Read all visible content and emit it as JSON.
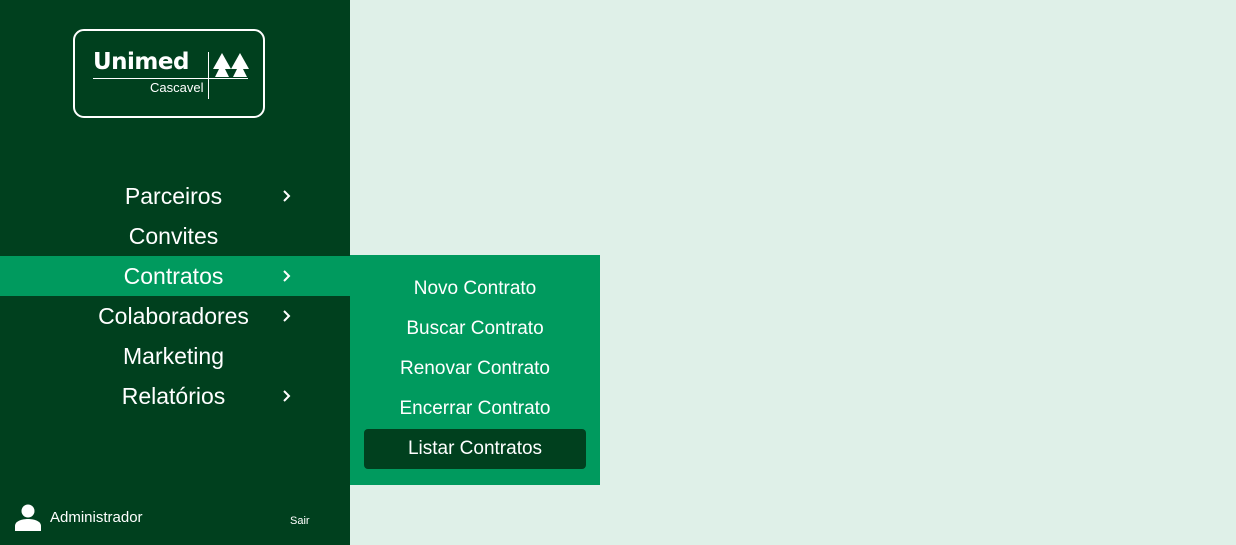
{
  "brand": {
    "name": "Unimed",
    "city": "Cascavel"
  },
  "nav": {
    "items": [
      {
        "label": "Parceiros",
        "has_submenu": true
      },
      {
        "label": "Convites",
        "has_submenu": false
      },
      {
        "label": "Contratos",
        "has_submenu": true,
        "active": true
      },
      {
        "label": "Colaboradores",
        "has_submenu": true
      },
      {
        "label": "Marketing",
        "has_submenu": false
      },
      {
        "label": "Relatórios",
        "has_submenu": true
      }
    ],
    "chevron_icon": "chevron-right-icon"
  },
  "submenu": {
    "parent": "Contratos",
    "items": [
      {
        "label": "Novo Contrato"
      },
      {
        "label": "Buscar Contrato"
      },
      {
        "label": "Renovar Contrato"
      },
      {
        "label": "Encerrar Contrato"
      },
      {
        "label": "Listar Contratos",
        "selected": true
      }
    ]
  },
  "footer": {
    "user_icon": "user-icon",
    "user_name": "Administrador",
    "logout_label": "Sair"
  },
  "colors": {
    "sidebar_bg": "#00401e",
    "accent": "#009a5e",
    "content_bg": "#dff0e8",
    "text": "#ffffff"
  }
}
